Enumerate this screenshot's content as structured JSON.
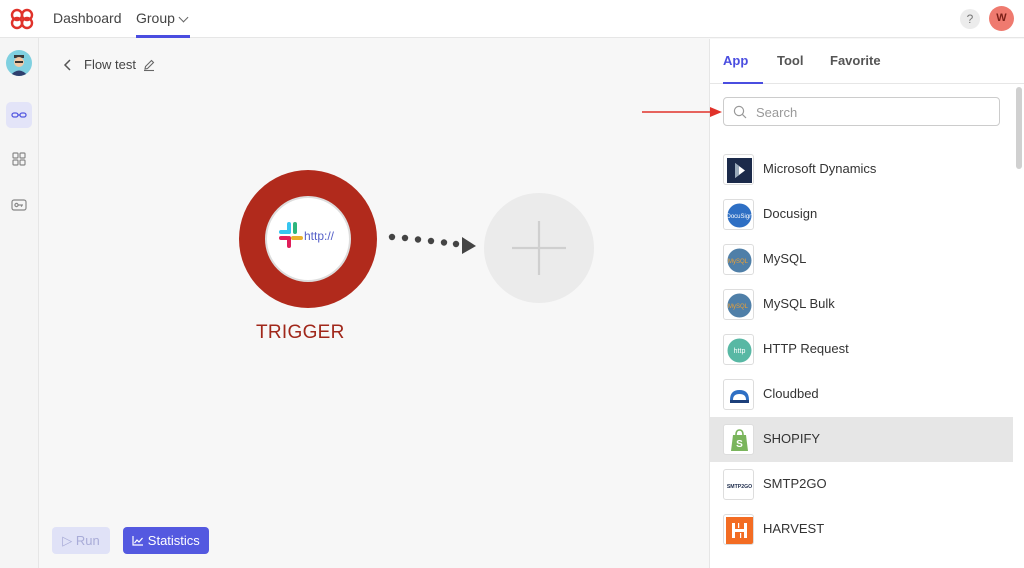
{
  "topbar": {
    "nav": {
      "dashboard": "Dashboard",
      "group": "Group"
    },
    "help": "?",
    "avatar_initial": "W"
  },
  "flow": {
    "title": "Flow test",
    "trigger_label": "TRIGGER",
    "trigger_text": "http://"
  },
  "buttons": {
    "run": "Run",
    "statistics": "Statistics"
  },
  "panel": {
    "tabs": [
      {
        "label": "App",
        "active": true
      },
      {
        "label": "Tool",
        "active": false
      },
      {
        "label": "Favorite",
        "active": false
      }
    ],
    "search": {
      "placeholder": "Search",
      "value": ""
    },
    "apps": [
      {
        "name": "Microsoft Dynamics",
        "icon": "microsoft-dynamics-logo",
        "selected": false
      },
      {
        "name": "Docusign",
        "icon": "docusign-logo",
        "selected": false
      },
      {
        "name": "MySQL",
        "icon": "mysql-logo",
        "selected": false
      },
      {
        "name": "MySQL Bulk",
        "icon": "mysql-logo",
        "selected": false
      },
      {
        "name": "HTTP Request",
        "icon": "http-logo",
        "selected": false
      },
      {
        "name": "Cloudbed",
        "icon": "cloudbed-logo",
        "selected": false
      },
      {
        "name": "SHOPIFY",
        "icon": "shopify-logo",
        "selected": true
      },
      {
        "name": "SMTP2GO",
        "icon": "smtp2go-logo",
        "selected": false
      },
      {
        "name": "HARVEST",
        "icon": "harvest-logo",
        "selected": false
      }
    ],
    "logo_text": {
      "docusign": "DocuSign",
      "mysql": "MySQL",
      "http": "http",
      "smtp2go": "SMTP2GO"
    }
  },
  "colors": {
    "accent": "#4a4de0",
    "trigger": "#b12a1c",
    "annotation": "#e0322a"
  }
}
